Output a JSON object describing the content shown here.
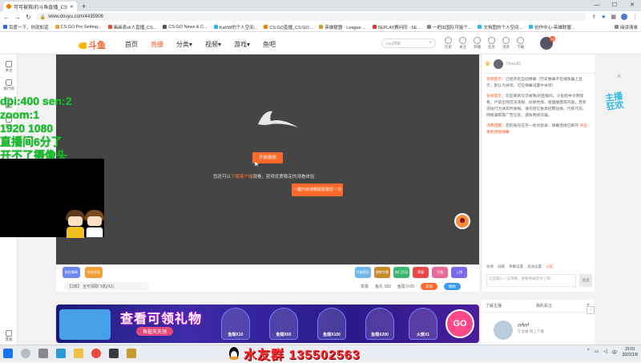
{
  "browser": {
    "tab_title": "可可被救i的斗鱼直播_CS:GO直播_",
    "new_tab": "+",
    "win_min": "—",
    "win_max": "☐",
    "win_close": "✕",
    "url": "www.douyu.com/4435908",
    "bookmarks": [
      "百度一下，你就知道",
      "CS:GO Pro Setting...",
      "画画表sl/人直播_CS...",
      "CS:GO News & C...",
      "KaKW的个人空间...",
      "CS:GO直播_CS:GO...",
      "英雄联盟 - League ...",
      "5EPLAY赛问同 - 5E...",
      "一把出国队可能个...",
      "文档图的个人空间...",
      "创作中心-英雄联盟..."
    ],
    "reading_list": "阅读清单"
  },
  "site": {
    "logo_text": "斗鱼",
    "nav": [
      "首页",
      "直播",
      "分类▾",
      "视频▾",
      "游戏▾",
      "鱼吧"
    ],
    "search_placeholder": "pyu搜索",
    "header_icons": [
      "历史",
      "关注",
      "开播",
      "任务",
      "消息",
      "下载"
    ],
    "user_badge": "38"
  },
  "rail": [
    "关注",
    "排行榜",
    "聊天",
    "会员",
    "客服"
  ],
  "player": {
    "open_button": "开启投放",
    "hint_prefix": "您还可以",
    "hint_link": "下载客户端",
    "hint_suffix": "观看，获得优质稳定的观看体验",
    "fluent_button": "一键开启流畅观看模式一次"
  },
  "overlay": {
    "lines": [
      "dpi:400 sen:2",
      "zoom:1",
      "1920 1080",
      "直播间6分了",
      "开不了摄像头"
    ]
  },
  "gift_bar": {
    "left_icons": [
      "粉丝徽章",
      "鱼丸好友"
    ],
    "room_id": "【2楼】 全可领取飞机(42)",
    "right_icons": [
      "年度报告",
      "超能专属",
      "热门活动",
      "荣耀",
      "主播",
      "上榜"
    ],
    "report_count": "举报",
    "gold_count": "鱼丸 183",
    "fish_count": "鱼翅 0.00",
    "btn_charge": "充值",
    "btn_pay": "缴纳"
  },
  "banner": {
    "title": "查看可领礼物",
    "subtitle": "鱼翅天天领",
    "cards": [
      "鱼翅X10",
      "鱼翅X50",
      "鱼翅X100",
      "鱼翅X200",
      "火箭X1"
    ],
    "go": "GO"
  },
  "chat": {
    "top_user": "Heisull2",
    "messages": [
      {
        "tag": "系统提示：",
        "text": "已经开启自动弹幕（历史弹幕不在播放器上显示，默认为关闭。可在弹幕设置中关闭）"
      },
      {
        "tag": "系统提示：",
        "text": "欢迎来到可可被救i的直播间。斗鱼倡导文明观看，严禁出现违法违规、低俗色情、吸烟酗酒等内容，若有违规行为请及时举报。请勿轻信各类招聘征婚、代练代充、网络兼职等广告信息，谨防网络诈骗。"
      },
      {
        "tag": "消费提醒：",
        "text": "您的账号在另一地点登录，弹幕连接已断开 ",
        "link": "点击重新连接弹幕"
      }
    ],
    "toolbar": [
      "表情",
      "屏蔽",
      "弹幕设置",
      "发送设置",
      "火焰"
    ],
    "input_placeholder": "这里输入一些弹幕，要要要被选中了哦~",
    "send": "发送"
  },
  "follow_card": {
    "tab_left": "了解主播",
    "tab_right": "我的关注",
    "name": "yyfyyf",
    "status": "在主播    线上下播"
  },
  "float": {
    "text": "主播狂欢",
    "close": "✕"
  },
  "promo": {
    "text": "水友群 135502563"
  },
  "clock": {
    "time": "15:01",
    "date": "2022/1/8"
  },
  "colors": {
    "accent": "#ff5d23",
    "player_bg": "#454545",
    "overlay_green": "#16c22a"
  }
}
